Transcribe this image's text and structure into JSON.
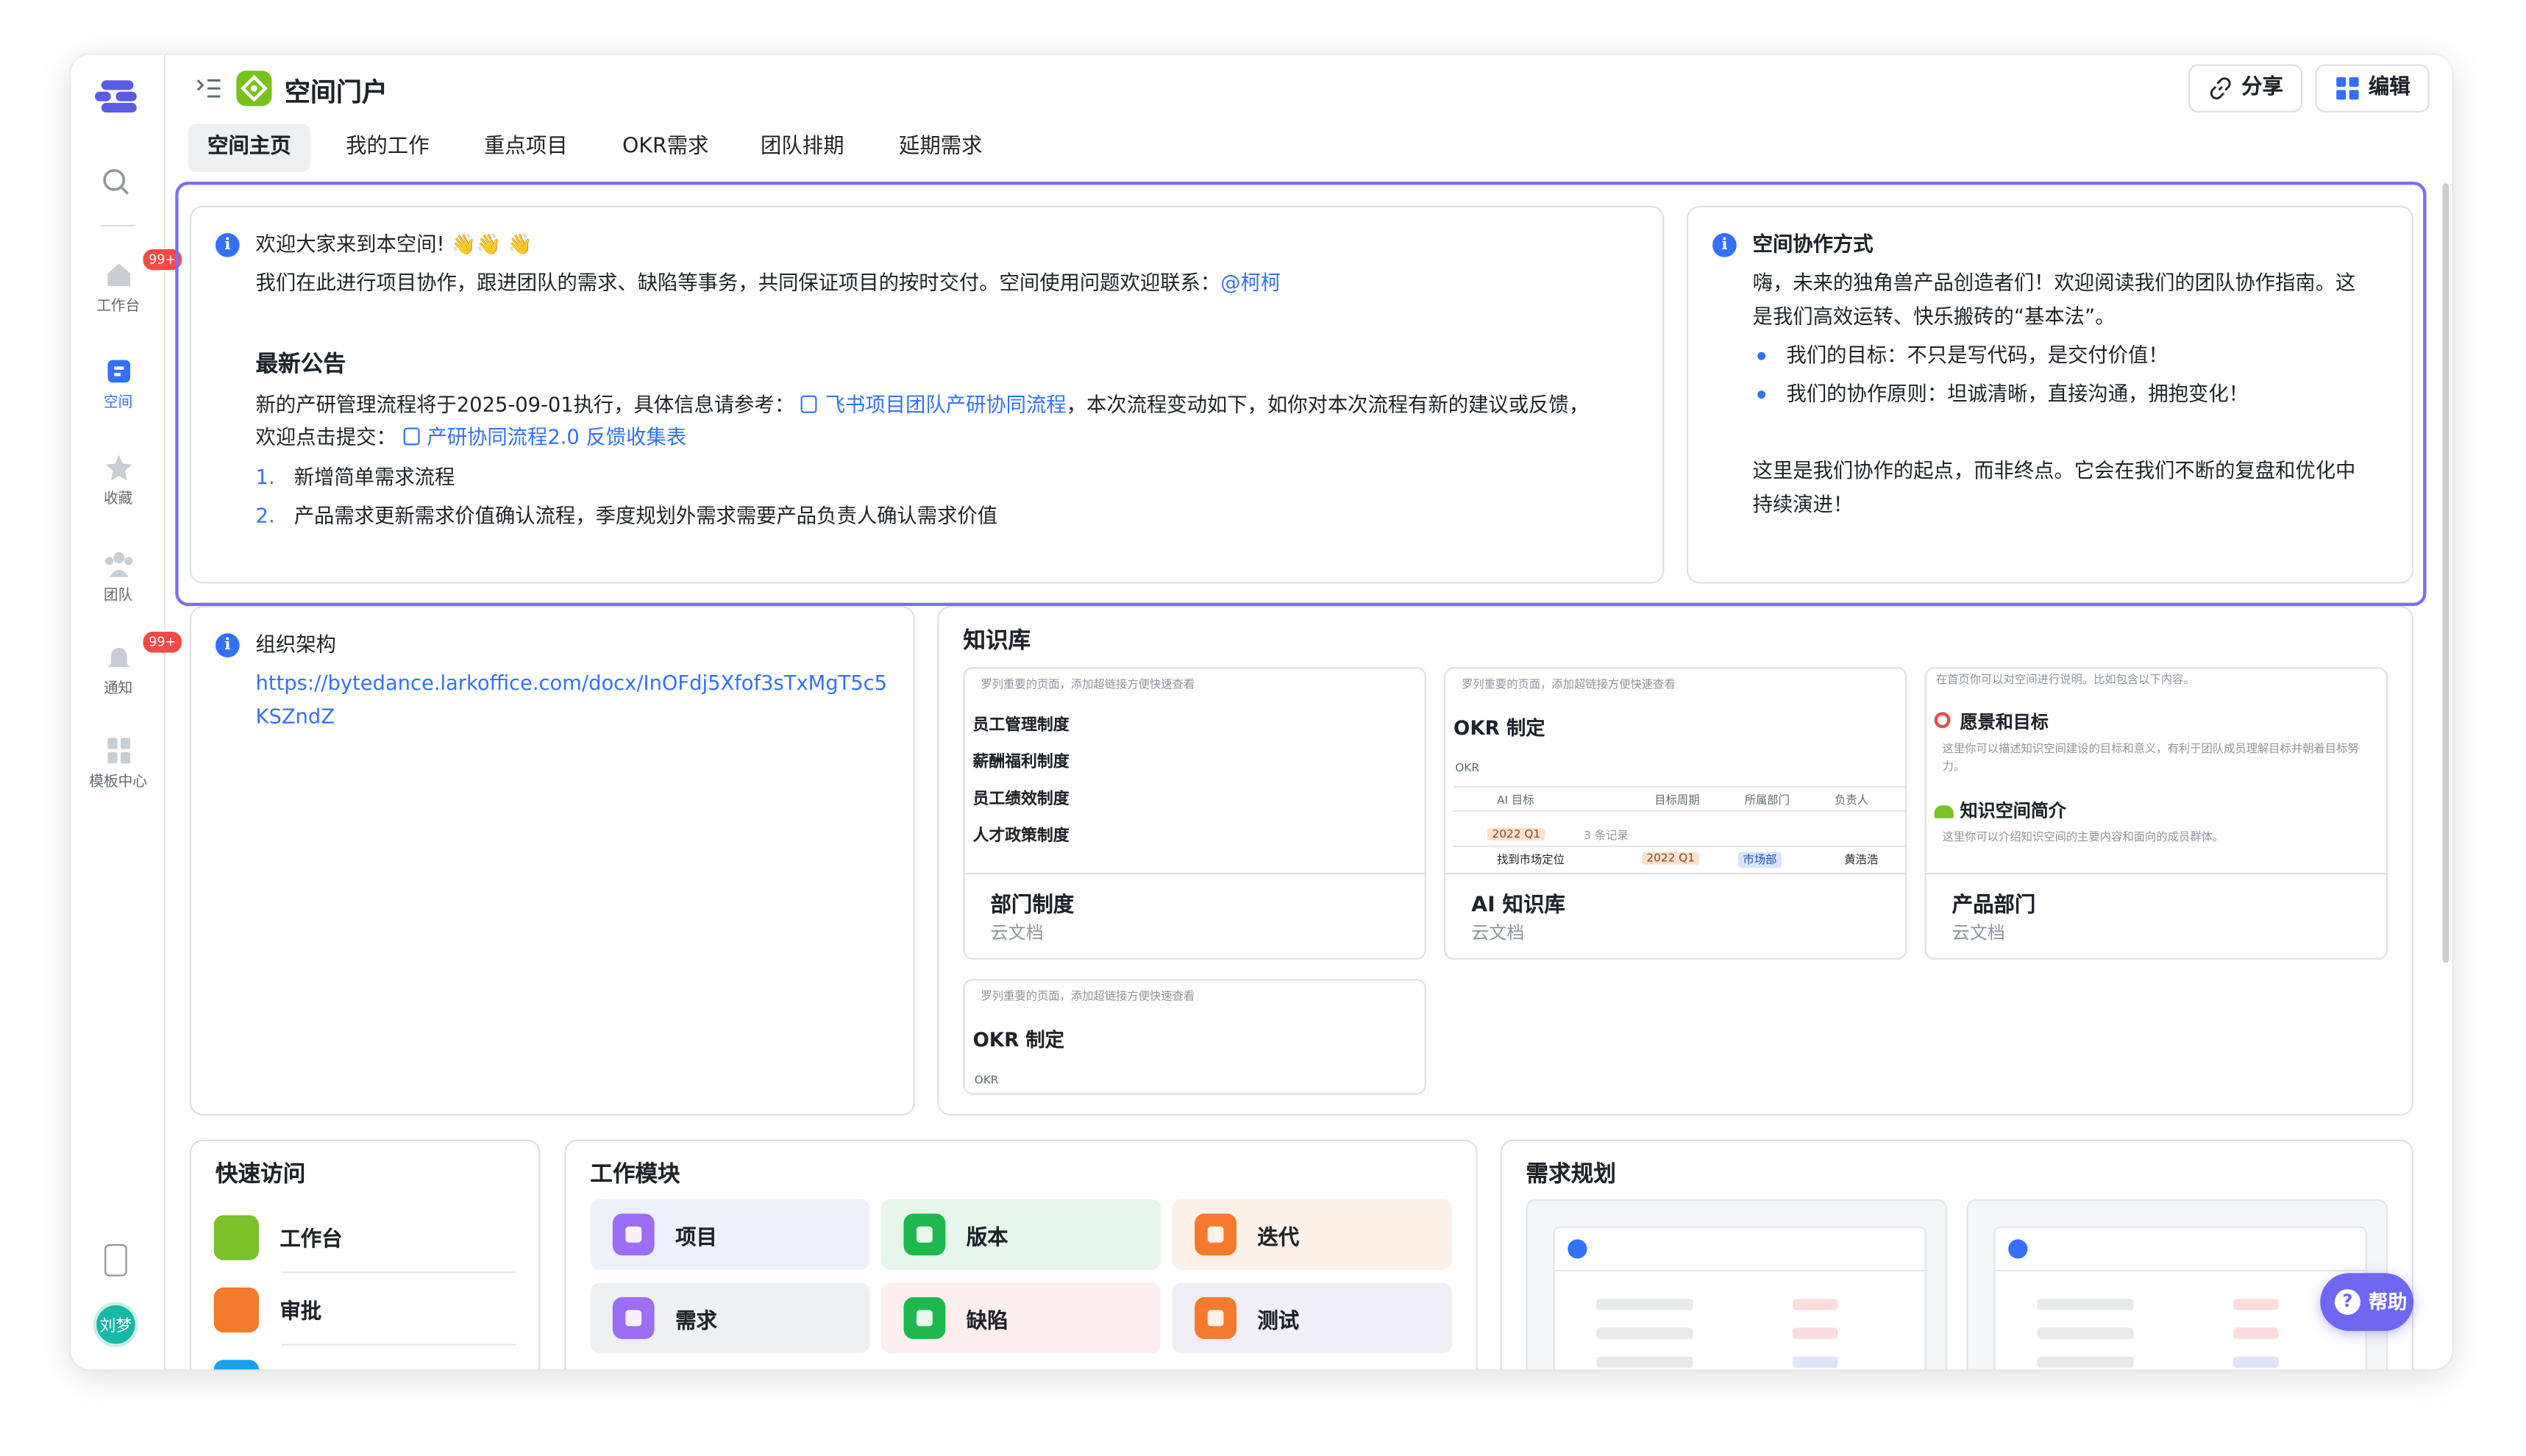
{
  "rail": {
    "items": [
      {
        "label": "工作台",
        "badge": "99+"
      },
      {
        "label": "空间",
        "badge": ""
      },
      {
        "label": "收藏",
        "badge": ""
      },
      {
        "label": "团队",
        "badge": ""
      },
      {
        "label": "通知",
        "badge": "99+"
      },
      {
        "label": "模板中心",
        "badge": ""
      }
    ],
    "avatar": "刘梦"
  },
  "header": {
    "title": "空间门户",
    "share_label": "分享",
    "edit_label": "编辑"
  },
  "tabs": [
    "空间主页",
    "我的工作",
    "重点项目",
    "OKR需求",
    "团队排期",
    "延期需求"
  ],
  "welcome": {
    "line1": "欢迎大家来到本空间! 👋👋 👋",
    "line2_prefix": "我们在此进行项目协作，跟进团队的需求、缺陷等事务，共同保证项目的按时交付。空间使用问题欢迎联系：",
    "line2_mention": "@柯柯",
    "announce_title": "最新公告",
    "announce_p1_prefix": "新的产研管理流程将于2025-09-01执行，具体信息请参考：",
    "announce_p1_link": "飞书项目团队产研协同流程",
    "announce_p1_suffix": "，本次流程变动如下，如你对本次流程有新的建议或反馈，",
    "announce_p2_prefix": "欢迎点击提交：",
    "announce_p2_link": "产研协同流程2.0 反馈收集表",
    "list": [
      {
        "num": "1.",
        "text": "新增简单需求流程"
      },
      {
        "num": "2.",
        "text": "产品需求更新需求价值确认流程，季度规划外需求需要产品负责人确认需求价值"
      }
    ]
  },
  "collab": {
    "title": "空间协作方式",
    "p1": "嗨，未来的独角兽产品创造者们！欢迎阅读我们的团队协作指南。这",
    "p2": "是我们高效运转、快乐搬砖的“基本法”。",
    "bullets": [
      "我们的目标：不只是写代码，是交付价值！",
      "我们的协作原则：坦诚清晰，直接沟通，拥抱变化！"
    ],
    "p3": "这里是我们协作的起点，而非终点。它会在我们不断的复盘和优化中",
    "p4": "持续演进！"
  },
  "org": {
    "title": "组织架构",
    "url1": "https://bytedance.larkoffice.com/docx/InOFdj5Xfof3sTxMgT5c5",
    "url2": "KSZndZ"
  },
  "knowledge": {
    "title": "知识库",
    "hint": "罗列重要的页面，添加超链接方便快速查看",
    "cards": [
      {
        "title": "部门制度",
        "sub": "云文档",
        "lines": [
          "员工管理制度",
          "薪酬福利制度",
          "员工绩效制度",
          "人才政策制度"
        ]
      },
      {
        "title": "AI 知识库",
        "sub": "云文档",
        "heading": "OKR 制定",
        "view": "OKR",
        "cols": [
          "AI 目标",
          "目标周期",
          "所属部门",
          "负责人"
        ],
        "group": "2022 Q1",
        "group_count": "3 条记录",
        "row": {
          "name": "找到市场定位",
          "period": "2022 Q1",
          "dept": "市场部",
          "owner": "黄浩浩"
        }
      },
      {
        "title": "产品部门",
        "sub": "云文档",
        "hint": "在首页你可以对空间进行说明。比如包含以下内容。",
        "s1": "愿景和目标",
        "s1d": "这里你可以描述知识空间建设的目标和意义，有利于团队成员理解目标并朝着目标努力。",
        "s2": "知识空间简介",
        "s2d": "这里你可以介绍知识空间的主要内容和面向的成员群体。"
      }
    ],
    "card4": {
      "heading": "OKR 制定",
      "view": "OKR"
    }
  },
  "quick": {
    "title": "快速访问",
    "items": [
      {
        "label": "工作台",
        "color": "#7cc12a"
      },
      {
        "label": "审批",
        "color": "#f57a2c"
      }
    ]
  },
  "modules": {
    "title": "工作模块",
    "items": [
      {
        "label": "项目",
        "icon": "#9b6ef3",
        "bg": "#eef1fb"
      },
      {
        "label": "版本",
        "icon": "#1fb84e",
        "bg": "#e6f6ea"
      },
      {
        "label": "迭代",
        "icon": "#f57a2c",
        "bg": "#fdf1e8"
      },
      {
        "label": "需求",
        "icon": "#9b6ef3",
        "bg": "#eff0f2"
      },
      {
        "label": "缺陷",
        "icon": "#1fb84e",
        "bg": "#fdeef0"
      },
      {
        "label": "测试",
        "icon": "#f57a2c",
        "bg": "#efeff5"
      }
    ]
  },
  "planning": {
    "title": "需求规划"
  },
  "help_label": "帮助",
  "colors": {
    "accent": "#3370ff",
    "selection": "#7b6ff0",
    "help": "#6f67f2",
    "badge": "#f54a45"
  }
}
